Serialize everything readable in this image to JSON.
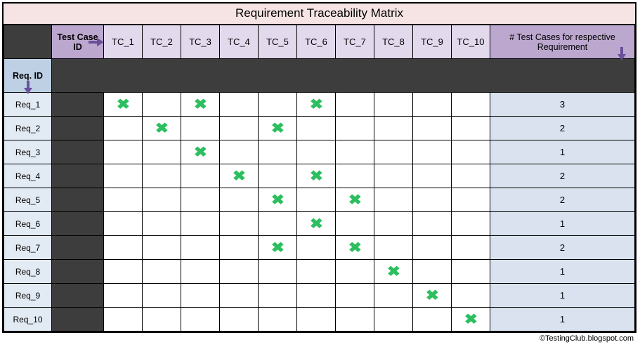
{
  "title": "Requirement Traceability Matrix",
  "headers": {
    "testCaseId": "Test Case ID",
    "countLabel": "# Test Cases for respective Requirement",
    "reqId": "Req. ID"
  },
  "testCases": [
    "TC_1",
    "TC_2",
    "TC_3",
    "TC_4",
    "TC_5",
    "TC_6",
    "TC_7",
    "TC_8",
    "TC_9",
    "TC_10"
  ],
  "requirements": [
    "Req_1",
    "Req_2",
    "Req_3",
    "Req_4",
    "Req_5",
    "Req_6",
    "Req_7",
    "Req_8",
    "Req_9",
    "Req_10"
  ],
  "matrix": [
    [
      1,
      0,
      1,
      0,
      0,
      1,
      0,
      0,
      0,
      0
    ],
    [
      0,
      1,
      0,
      0,
      1,
      0,
      0,
      0,
      0,
      0
    ],
    [
      0,
      0,
      1,
      0,
      0,
      0,
      0,
      0,
      0,
      0
    ],
    [
      0,
      0,
      0,
      1,
      0,
      1,
      0,
      0,
      0,
      0
    ],
    [
      0,
      0,
      0,
      0,
      1,
      0,
      1,
      0,
      0,
      0
    ],
    [
      0,
      0,
      0,
      0,
      0,
      1,
      0,
      0,
      0,
      0
    ],
    [
      0,
      0,
      0,
      0,
      1,
      0,
      1,
      0,
      0,
      0
    ],
    [
      0,
      0,
      0,
      0,
      0,
      0,
      0,
      1,
      0,
      0
    ],
    [
      0,
      0,
      0,
      0,
      0,
      0,
      0,
      0,
      1,
      0
    ],
    [
      0,
      0,
      0,
      0,
      0,
      0,
      0,
      0,
      0,
      1
    ]
  ],
  "counts": [
    3,
    2,
    1,
    2,
    2,
    1,
    2,
    1,
    1,
    1
  ],
  "footer": "©TestingClub.blogspot.com",
  "chart_data": {
    "type": "table",
    "title": "Requirement Traceability Matrix",
    "columns": [
      "TC_1",
      "TC_2",
      "TC_3",
      "TC_4",
      "TC_5",
      "TC_6",
      "TC_7",
      "TC_8",
      "TC_9",
      "TC_10",
      "# Test Cases for respective Requirement"
    ],
    "rows": [
      "Req_1",
      "Req_2",
      "Req_3",
      "Req_4",
      "Req_5",
      "Req_6",
      "Req_7",
      "Req_8",
      "Req_9",
      "Req_10"
    ],
    "cells": [
      [
        "x",
        "",
        "x",
        "",
        "",
        "x",
        "",
        "",
        "",
        "",
        3
      ],
      [
        "",
        "x",
        "",
        "",
        "x",
        "",
        "",
        "",
        "",
        "",
        2
      ],
      [
        "",
        "",
        "x",
        "",
        "",
        "",
        "",
        "",
        "",
        "",
        1
      ],
      [
        "",
        "",
        "",
        "x",
        "",
        "x",
        "",
        "",
        "",
        "",
        2
      ],
      [
        "",
        "",
        "",
        "",
        "x",
        "",
        "x",
        "",
        "",
        "",
        2
      ],
      [
        "",
        "",
        "",
        "",
        "",
        "x",
        "",
        "",
        "",
        "",
        1
      ],
      [
        "",
        "",
        "",
        "",
        "x",
        "",
        "x",
        "",
        "",
        "",
        2
      ],
      [
        "",
        "",
        "",
        "",
        "",
        "",
        "",
        "x",
        "",
        "",
        1
      ],
      [
        "",
        "",
        "",
        "",
        "",
        "",
        "",
        "",
        "x",
        "",
        1
      ],
      [
        "",
        "",
        "",
        "",
        "",
        "",
        "",
        "",
        "",
        "x",
        1
      ]
    ]
  }
}
